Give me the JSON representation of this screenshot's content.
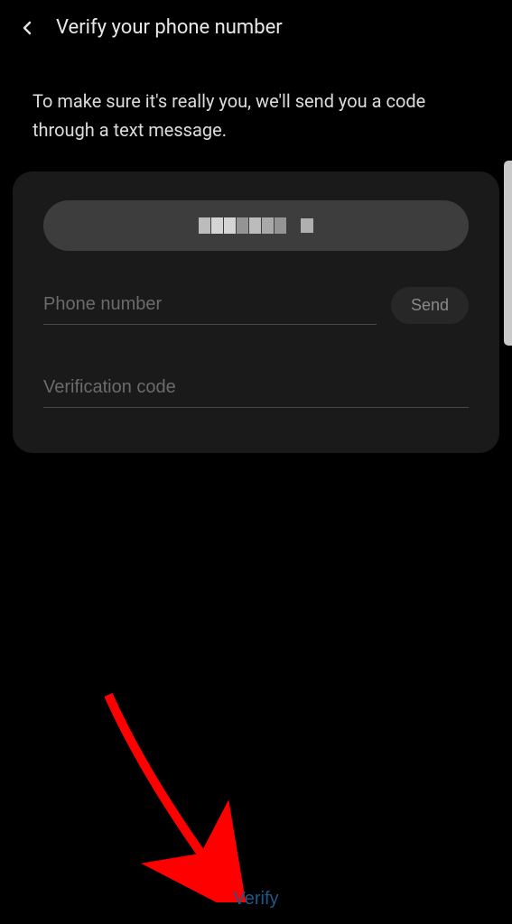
{
  "header": {
    "title": "Verify your phone number"
  },
  "description": "To make sure it's really you, we'll send you a code through a text message.",
  "form": {
    "phone_placeholder": "Phone number",
    "code_placeholder": "Verification code",
    "send_label": "Send"
  },
  "footer": {
    "verify_label": "Verify"
  }
}
